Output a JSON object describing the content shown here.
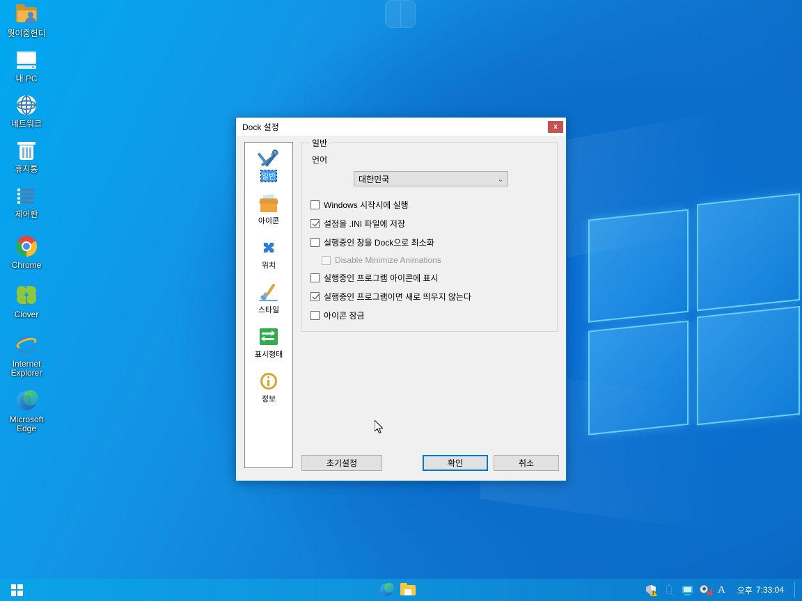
{
  "desktop": {
    "icons": [
      {
        "label": "뭣이중헌디",
        "icon": "folder-user-icon"
      },
      {
        "label": "내 PC",
        "icon": "monitor-icon"
      },
      {
        "label": "네트워크",
        "icon": "globe-icon"
      },
      {
        "label": "휴지통",
        "icon": "recycle-bin-icon"
      },
      {
        "label": "제어판",
        "icon": "control-panel-icon"
      },
      {
        "label": "Chrome",
        "icon": "chrome-icon"
      },
      {
        "label": "Clover",
        "icon": "clover-icon"
      },
      {
        "label": "Internet Explorer",
        "icon": "internet-explorer-icon"
      },
      {
        "label": "Microsoft Edge",
        "icon": "microsoft-edge-icon"
      }
    ]
  },
  "taskbar": {
    "start_icon": "windows-start-icon",
    "apps": [
      {
        "name": "microsoft-edge-taskbar-icon"
      },
      {
        "name": "file-explorer-taskbar-icon"
      }
    ],
    "tray": [
      {
        "name": "security-shield-warning-icon"
      },
      {
        "name": "safely-remove-usb-icon"
      },
      {
        "name": "display-monitor-icon"
      },
      {
        "name": "volume-icon"
      }
    ],
    "ime_indicator": "A",
    "clock_period": "오후",
    "clock_time": "7:33:04"
  },
  "dialog": {
    "title": "Dock 설정",
    "close_label": "x",
    "nav": [
      {
        "label": "일반",
        "icon": "tools-icon",
        "selected": true
      },
      {
        "label": "아이콘",
        "icon": "box-icon",
        "selected": false
      },
      {
        "label": "위치",
        "icon": "move-arrows-icon",
        "selected": false
      },
      {
        "label": "스타일",
        "icon": "paintbrush-icon",
        "selected": false
      },
      {
        "label": "표시형태",
        "icon": "swap-arrows-icon",
        "selected": false
      },
      {
        "label": "정보",
        "icon": "info-icon",
        "selected": false
      }
    ],
    "group": {
      "title": "일반",
      "language_label": "언어",
      "language_value": "대한민국",
      "language_chevron": "⌄"
    },
    "checkboxes": [
      {
        "label": "Windows 시작시에 실행",
        "checked": false,
        "disabled": false,
        "indent": false
      },
      {
        "label": "설정을 .INI 파일에 저장",
        "checked": true,
        "disabled": false,
        "indent": false
      },
      {
        "label": "실행중인 창을 Dock으로 최소화",
        "checked": false,
        "disabled": false,
        "indent": false
      },
      {
        "label": "Disable Minimize Animations",
        "checked": false,
        "disabled": true,
        "indent": true
      },
      {
        "label": "실행중인 프로그램 아이콘에 표시",
        "checked": false,
        "disabled": false,
        "indent": false
      },
      {
        "label": "실행중인 프로그램이면 새로 띄우지 않는다",
        "checked": true,
        "disabled": false,
        "indent": false
      },
      {
        "label": "아이콘 잠금",
        "checked": false,
        "disabled": false,
        "indent": false
      }
    ],
    "buttons": {
      "defaults": "초기설정",
      "ok": "확인",
      "cancel": "취소"
    }
  },
  "colors": {
    "accent": "#0078d7",
    "close_button": "#c75050",
    "selection": "#3399ff",
    "taskbar": "#0d93dd",
    "dialog_bg": "#f0f0f0"
  }
}
